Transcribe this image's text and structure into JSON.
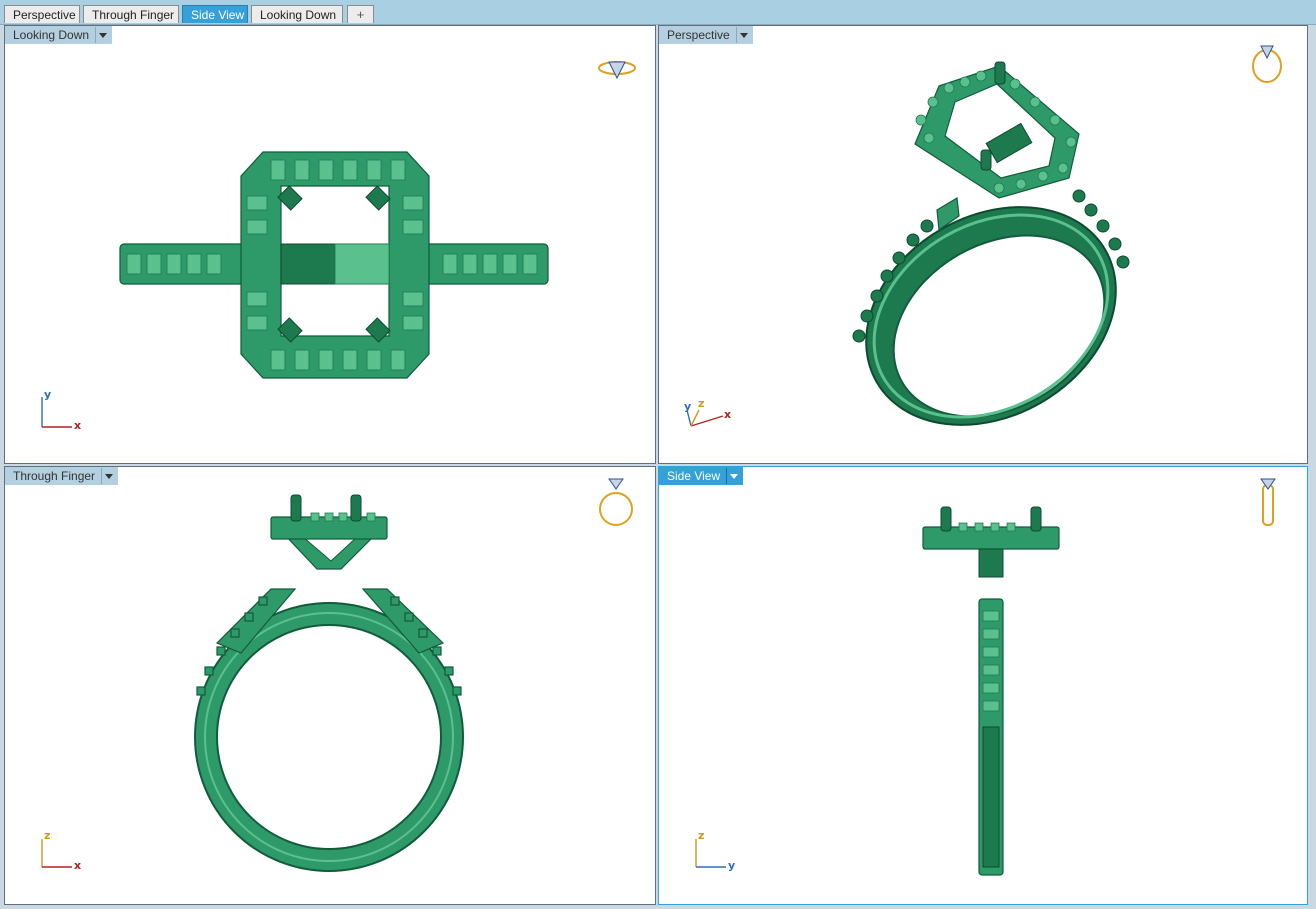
{
  "tabs": [
    {
      "label": "Perspective",
      "active": false
    },
    {
      "label": "Through Finger",
      "active": false
    },
    {
      "label": "Side View",
      "active": true
    },
    {
      "label": "Looking Down",
      "active": false
    }
  ],
  "add_tab_glyph": "+",
  "viewports": {
    "top_left": {
      "label": "Looking Down",
      "axes": [
        "y",
        "x"
      ]
    },
    "top_right": {
      "label": "Perspective",
      "axes": [
        "y",
        "z",
        "x"
      ]
    },
    "bottom_left": {
      "label": "Through Finger",
      "axes": [
        "z",
        "x"
      ]
    },
    "bottom_right": {
      "label": "Side View",
      "axes": [
        "z",
        "y"
      ],
      "active": true
    }
  },
  "colors": {
    "model": "#2e9a6a",
    "active_accent": "#36a0d9",
    "axis_x": "#b0241c",
    "axis_y": "#2f6fb8",
    "axis_z": "#c89a1e"
  },
  "icons": [
    "ring-top-view-icon",
    "ring-perspective-icon",
    "ring-front-icon",
    "ring-side-icon"
  ]
}
